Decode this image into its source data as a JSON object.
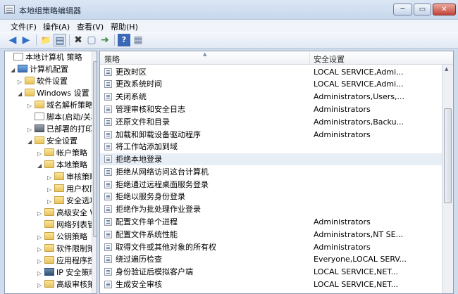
{
  "window": {
    "title": "本地组策略编辑器",
    "min": "─",
    "max": "▭",
    "close": "✕"
  },
  "menu": [
    "文件(F)",
    "操作(A)",
    "查看(V)",
    "帮助(H)"
  ],
  "toolbar": {
    "back": "◀",
    "forward": "▶",
    "up": "📁",
    "view": "▤",
    "delete": "✖",
    "properties": "▢",
    "export": "➜",
    "help": "?",
    "show": "▦"
  },
  "tree": [
    {
      "label": "本地计算机 策略",
      "icon": "doc-icon",
      "arrow": ""
    },
    {
      "label": "计算机配置",
      "icon": "computer-icon",
      "arrow": "◢"
    },
    {
      "label": "软件设置",
      "icon": "folder-icon",
      "arrow": "▷"
    },
    {
      "label": "Windows 设置",
      "icon": "folder-icon",
      "arrow": "◢"
    },
    {
      "label": "域名解析策略",
      "icon": "folder-icon",
      "arrow": "▷"
    },
    {
      "label": "脚本(启动/关机)",
      "icon": "script-icon",
      "arrow": ""
    },
    {
      "label": "已部署的打印机",
      "icon": "printer-icon",
      "arrow": "▷"
    },
    {
      "label": "安全设置",
      "icon": "security-folder-icon",
      "arrow": "◢"
    },
    {
      "label": "帐户策略",
      "icon": "folder-icon",
      "arrow": "▷"
    },
    {
      "label": "本地策略",
      "icon": "folder-icon",
      "arrow": "◢"
    },
    {
      "label": "审核策略",
      "icon": "lock-folder-icon",
      "arrow": "▷"
    },
    {
      "label": "用户权限分配",
      "icon": "lock-folder-icon",
      "arrow": "▷"
    },
    {
      "label": "安全选项",
      "icon": "lock-folder-icon",
      "arrow": "▷"
    },
    {
      "label": "高级安全 Windows 防火墙",
      "icon": "folder-icon",
      "arrow": "▷"
    },
    {
      "label": "网络列表管理器策略",
      "icon": "folder-icon",
      "arrow": ""
    },
    {
      "label": "公钥策略",
      "icon": "folder-icon",
      "arrow": "▷"
    },
    {
      "label": "软件限制策略",
      "icon": "folder-icon",
      "arrow": "▷"
    },
    {
      "label": "应用程序控制策略",
      "icon": "folder-icon",
      "arrow": "▷"
    },
    {
      "label": "IP 安全策略",
      "icon": "ip-security-icon",
      "arrow": "▷"
    },
    {
      "label": "高级审核策略配置",
      "icon": "folder-icon",
      "arrow": "▷"
    }
  ],
  "list": {
    "columns": [
      "策略",
      "安全设置"
    ],
    "rows": [
      {
        "policy": "更改时区",
        "setting": "LOCAL SERVICE,Admi..."
      },
      {
        "policy": "更改系统时间",
        "setting": "LOCAL SERVICE,Admi..."
      },
      {
        "policy": "关闭系统",
        "setting": "Administrators,Users,..."
      },
      {
        "policy": "管理审核和安全日志",
        "setting": "Administrators"
      },
      {
        "policy": "还原文件和目录",
        "setting": "Administrators,Backu..."
      },
      {
        "policy": "加载和卸载设备驱动程序",
        "setting": "Administrators"
      },
      {
        "policy": "将工作站添加到域",
        "setting": ""
      },
      {
        "policy": "拒绝本地登录",
        "setting": ""
      },
      {
        "policy": "拒绝从网络访问这台计算机",
        "setting": ""
      },
      {
        "policy": "拒绝通过远程桌面服务登录",
        "setting": ""
      },
      {
        "policy": "拒绝以服务身份登录",
        "setting": ""
      },
      {
        "policy": "拒绝作为批处理作业登录",
        "setting": ""
      },
      {
        "policy": "配置文件单个进程",
        "setting": "Administrators"
      },
      {
        "policy": "配置文件系统性能",
        "setting": "Administrators,NT SE..."
      },
      {
        "policy": "取得文件或其他对象的所有权",
        "setting": "Administrators"
      },
      {
        "policy": "绕过遍历检查",
        "setting": "Everyone,LOCAL SERV..."
      },
      {
        "policy": "身份验证后模拟客户端",
        "setting": "LOCAL SERVICE,NET..."
      },
      {
        "policy": "生成安全审核",
        "setting": "LOCAL SERVICE,NET..."
      }
    ]
  }
}
